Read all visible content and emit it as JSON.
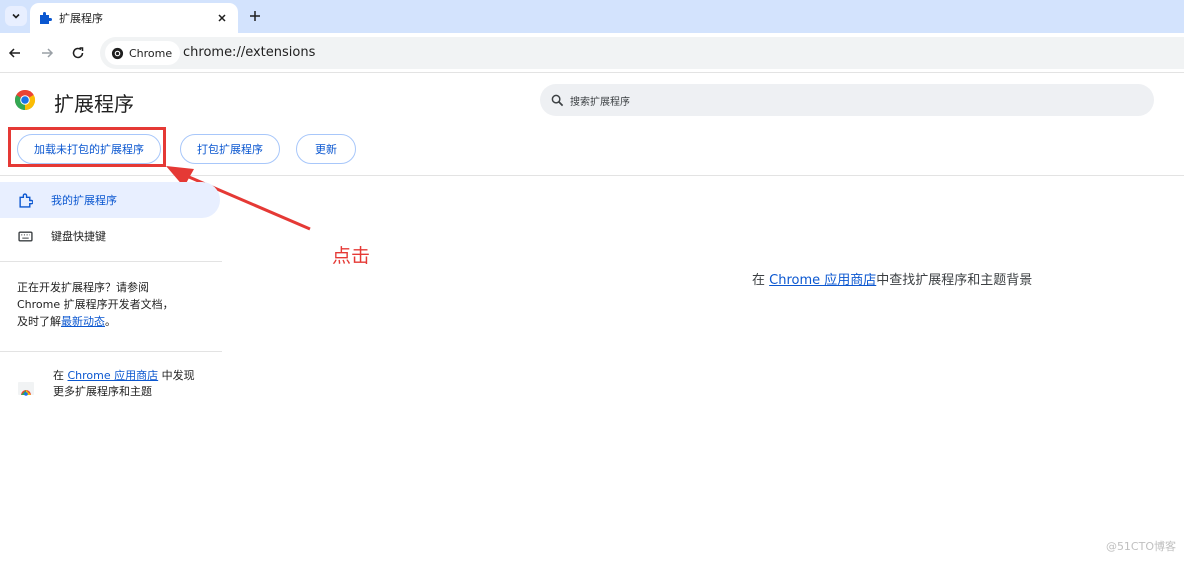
{
  "tab": {
    "title": "扩展程序"
  },
  "toolbar": {
    "site_chip": "Chrome",
    "url": "chrome://extensions"
  },
  "header": {
    "title": "扩展程序",
    "search_placeholder": "搜索扩展程序"
  },
  "actions": {
    "load_unpacked": "加载未打包的扩展程序",
    "pack": "打包扩展程序",
    "update": "更新"
  },
  "annotation": {
    "label": "点击"
  },
  "sidebar": {
    "items": [
      {
        "label": "我的扩展程序",
        "icon": "extension-icon",
        "active": true
      },
      {
        "label": "键盘快捷键",
        "icon": "keyboard-icon",
        "active": false
      }
    ],
    "dev_text_1": "正在开发扩展程序？请参阅",
    "dev_text_2": "Chrome 扩展程序开发者文档，",
    "dev_text_3_prefix": "及时了解",
    "dev_text_link": "最新动态",
    "dev_text_3_suffix": "。",
    "store_prefix": "在 ",
    "store_link": "Chrome 应用商店",
    "store_suffix": " 中发现更多扩展程序和主题"
  },
  "main": {
    "msg_prefix": "在 ",
    "msg_link": "Chrome 应用商店",
    "msg_suffix": "中查找扩展程序和主题背景"
  },
  "watermark": "@51CTO博客",
  "colors": {
    "accent": "#0b57d0",
    "annotation": "#e53935",
    "tabstrip": "#d3e3fd"
  }
}
